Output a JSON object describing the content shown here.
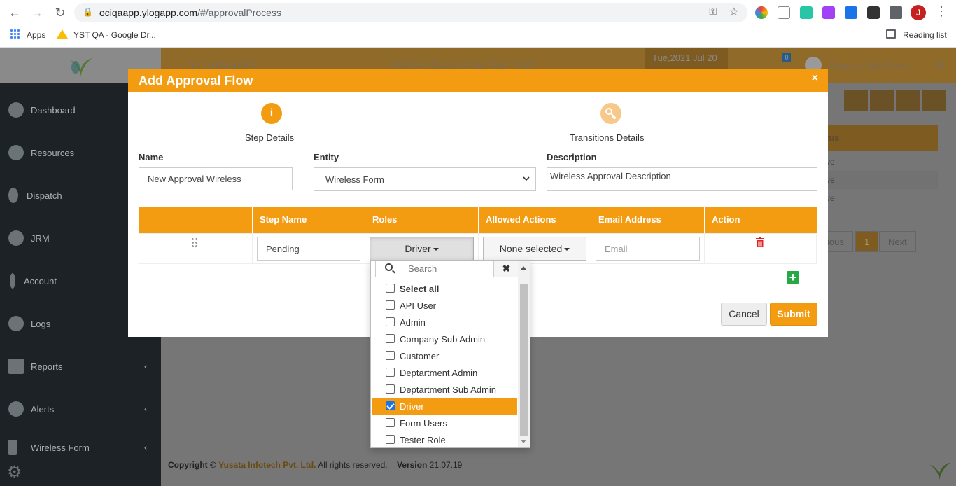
{
  "browser": {
    "url_host": "ociqaapp.ylogapp.com",
    "url_path": "/#/approvalProcess",
    "avatar_letter": "J",
    "bookmarks": [
      "Apps",
      "YST QA - Google Dr..."
    ],
    "reading_list": "Reading list"
  },
  "app": {
    "title": "YLogAppV2",
    "company": "QA Professionals Pvt. Ltd",
    "date": "Tue,2021 Jul 20",
    "notifications": "0",
    "user": "Sharma, Juhi Comp",
    "sidebar": [
      {
        "label": "Dashboard",
        "icon": "dashboard-icon"
      },
      {
        "label": "Resources",
        "icon": "users-icon"
      },
      {
        "label": "Dispatch",
        "icon": "map-pin-icon"
      },
      {
        "label": "JRM",
        "icon": "gear-icon"
      },
      {
        "label": "Account",
        "icon": "thermometer-icon"
      },
      {
        "label": "Logs",
        "icon": "clock-icon"
      },
      {
        "label": "Reports",
        "icon": "list-icon"
      },
      {
        "label": "Alerts",
        "icon": "bell-icon"
      },
      {
        "label": "Wireless Form",
        "icon": "mobile-icon"
      }
    ],
    "background_table": {
      "status_header": "tus",
      "rows": [
        "ve",
        "ve",
        "ve"
      ],
      "pager": {
        "prev": "ious",
        "current": "1",
        "next": "Next"
      }
    },
    "footer": {
      "copyright": "Copyright ©",
      "company": "Yusata Infotech Pvt. Ltd.",
      "rights": "All rights reserved.",
      "version_label": "Version",
      "version": "21.07.19"
    }
  },
  "modal": {
    "title": "Add Approval Flow",
    "close": "×",
    "steps": [
      {
        "label": "Step Details",
        "icon": "i"
      },
      {
        "label": "Transitions Details",
        "icon": "key-icon"
      }
    ],
    "fields": {
      "name_label": "Name",
      "name_value": "New Approval Wireless",
      "entity_label": "Entity",
      "entity_value": "Wireless Form",
      "description_label": "Description",
      "description_value": "Wireless Approval Description"
    },
    "table": {
      "headers": [
        "",
        "Step Name",
        "Roles",
        "Allowed Actions",
        "Email Address",
        "Action"
      ],
      "row": {
        "step_name": "Pending",
        "roles": "Driver",
        "allowed_actions": "None selected",
        "email_placeholder": "Email"
      }
    },
    "buttons": {
      "cancel": "Cancel",
      "submit": "Submit"
    }
  },
  "roles_dropdown": {
    "search_placeholder": "Search",
    "clear": "✖",
    "options": [
      {
        "label": "Select all",
        "checked": false
      },
      {
        "label": "API User",
        "checked": false
      },
      {
        "label": "Admin",
        "checked": false
      },
      {
        "label": "Company Sub Admin",
        "checked": false
      },
      {
        "label": "Customer",
        "checked": false
      },
      {
        "label": "Deptartment Admin",
        "checked": false
      },
      {
        "label": "Deptartment Sub Admin",
        "checked": false
      },
      {
        "label": "Driver",
        "checked": true
      },
      {
        "label": "Form Users",
        "checked": false
      },
      {
        "label": "Tester Role",
        "checked": false
      }
    ]
  },
  "colors": {
    "accent": "#f39c12",
    "sidebar": "#1c2226",
    "add": "#27a844",
    "delete": "#e02424"
  }
}
